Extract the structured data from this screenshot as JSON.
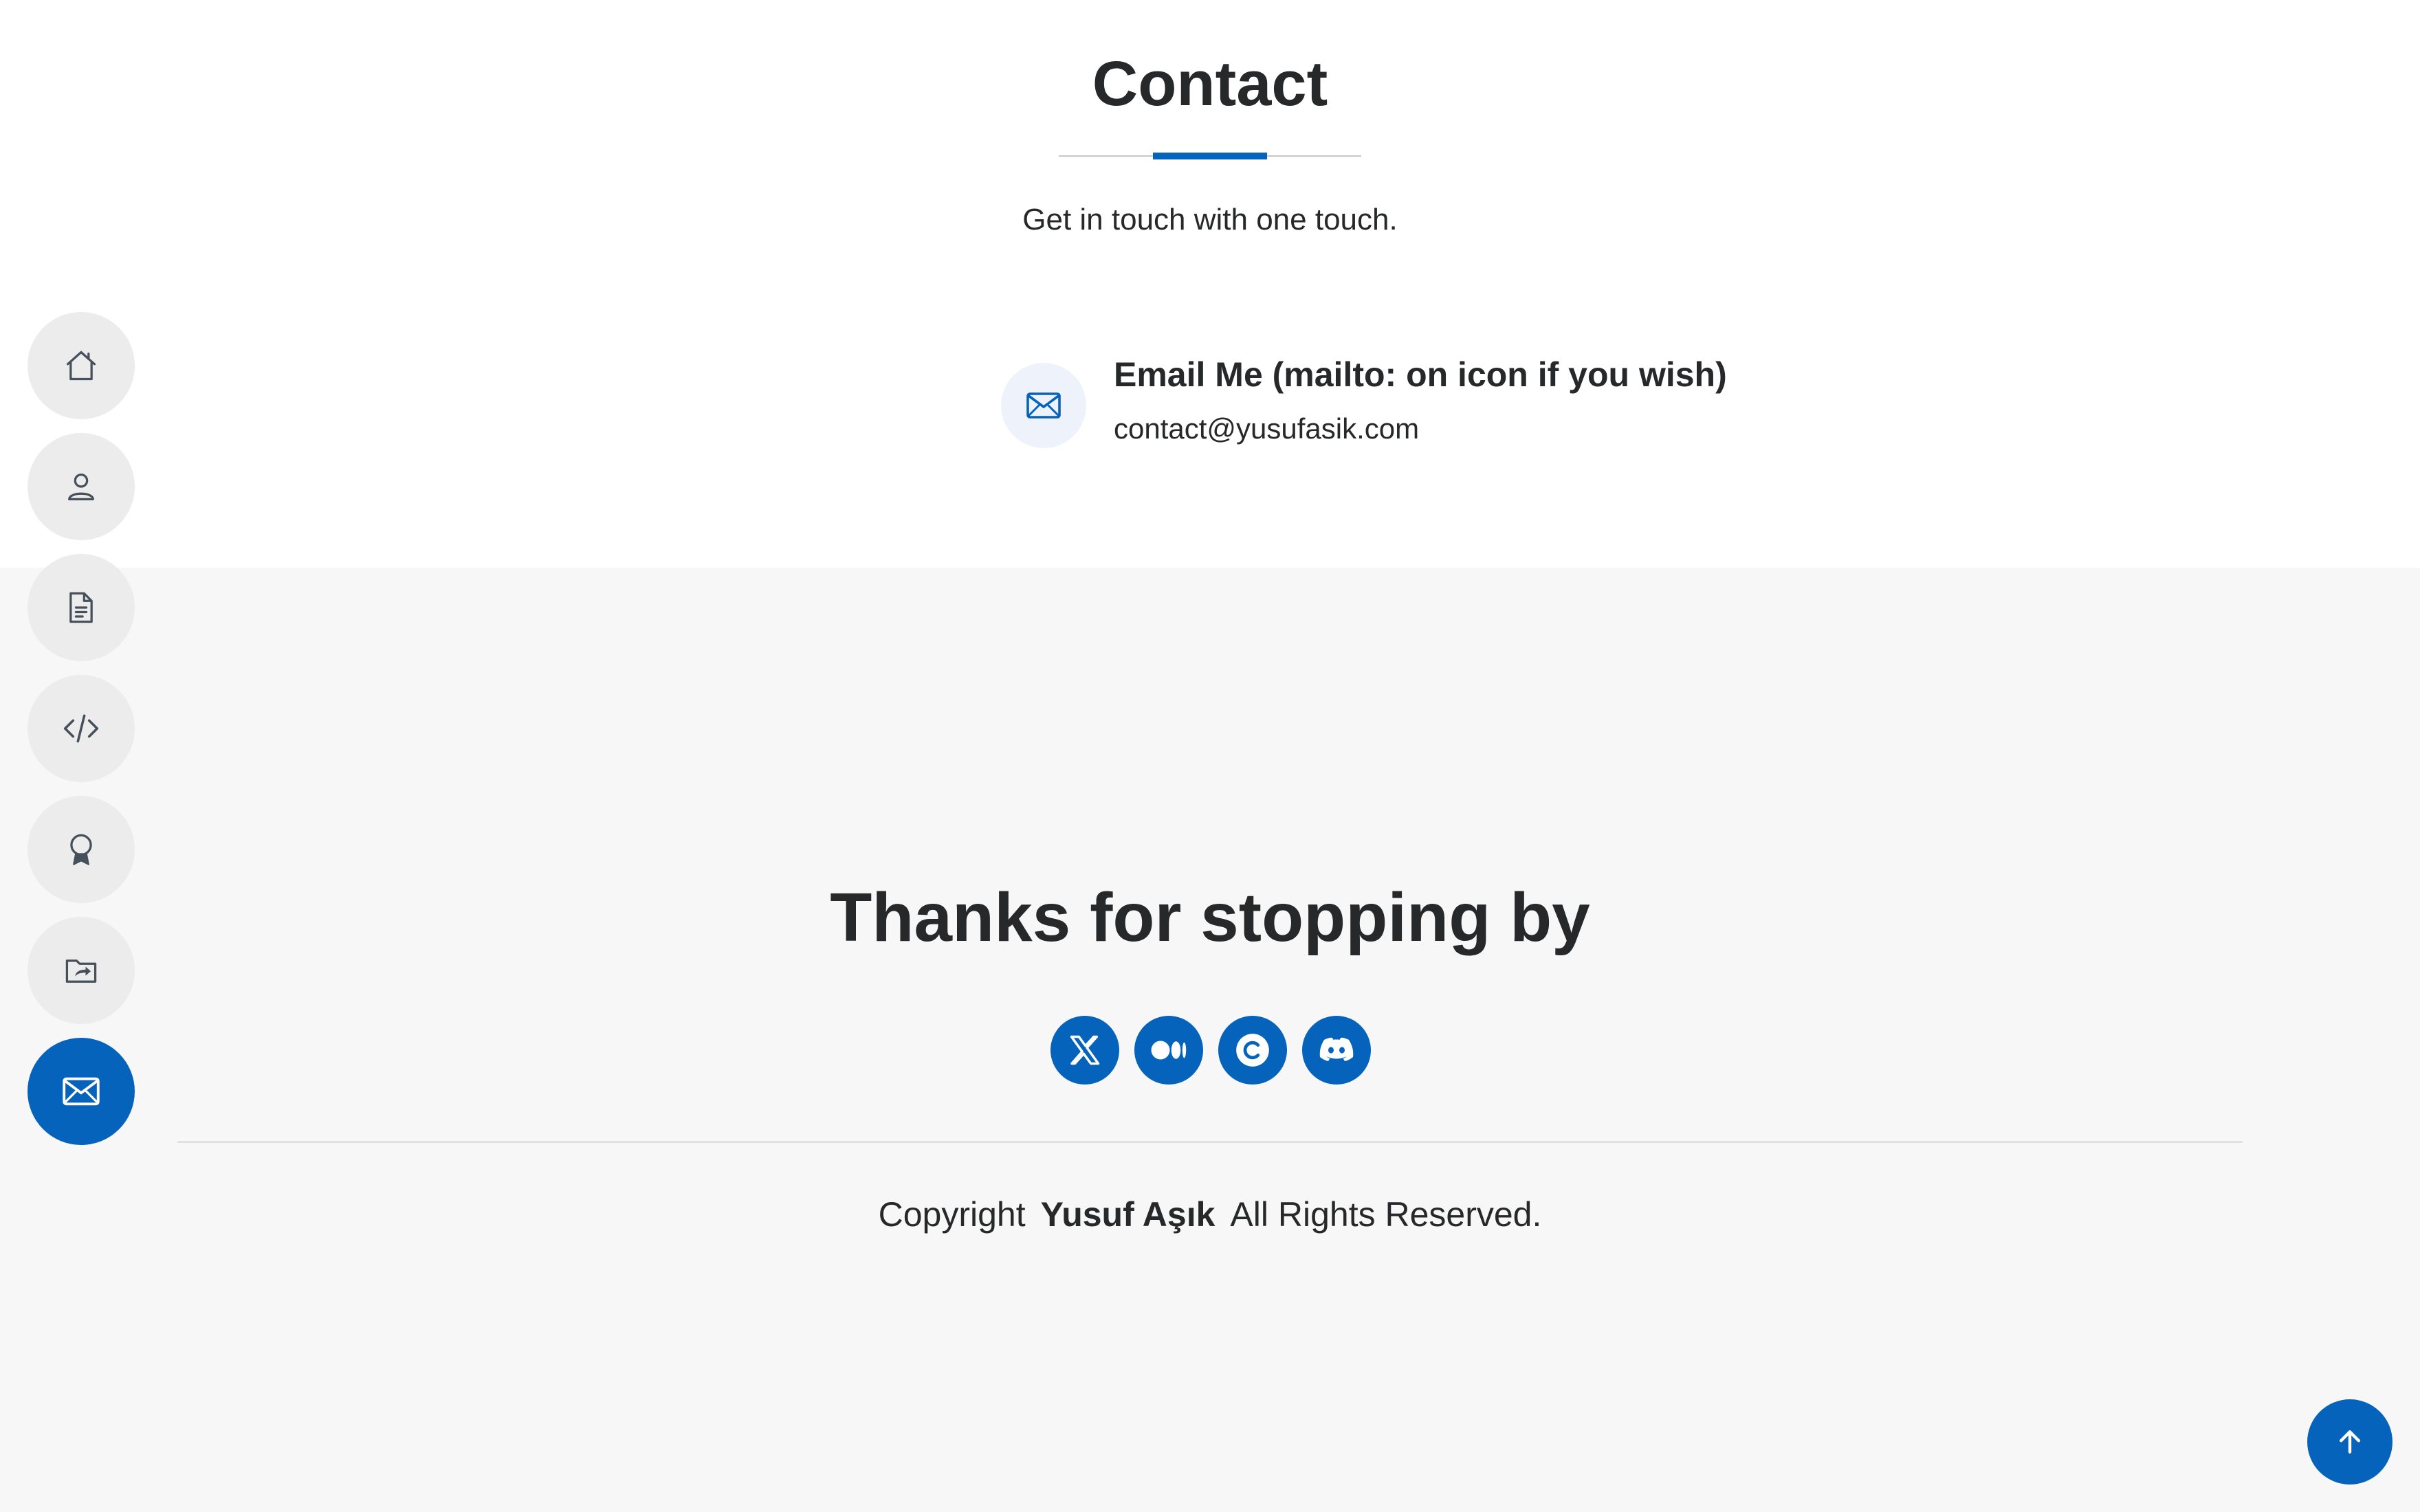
{
  "contact": {
    "title": "Contact",
    "subtitle": "Get in touch with one touch.",
    "email_title": "Email Me (mailto: on icon if you wish)",
    "email_value": "contact@yusufasik.com",
    "email_icon": "envelope-icon"
  },
  "footer": {
    "heading": "Thanks for stopping by",
    "social": [
      {
        "name": "x-twitter-icon"
      },
      {
        "name": "medium-icon"
      },
      {
        "name": "c-icon"
      },
      {
        "name": "discord-icon"
      }
    ],
    "copyright_prefix": "Copyright",
    "copyright_owner": "Yusuf Aşık",
    "copyright_suffix": "All Rights Reserved."
  },
  "side_nav": {
    "items": [
      {
        "icon": "home-icon",
        "active": false
      },
      {
        "icon": "person-icon",
        "active": false
      },
      {
        "icon": "file-text-icon",
        "active": false
      },
      {
        "icon": "code-icon",
        "active": false
      },
      {
        "icon": "award-icon",
        "active": false
      },
      {
        "icon": "folder-share-icon",
        "active": false
      },
      {
        "icon": "envelope-icon",
        "active": true
      }
    ]
  },
  "back_to_top": {
    "icon": "arrow-up-icon"
  },
  "colors": {
    "accent": "#0563bb",
    "text": "#272829",
    "footer_bg": "#f7f7f7",
    "nav_bg": "#ececec"
  }
}
